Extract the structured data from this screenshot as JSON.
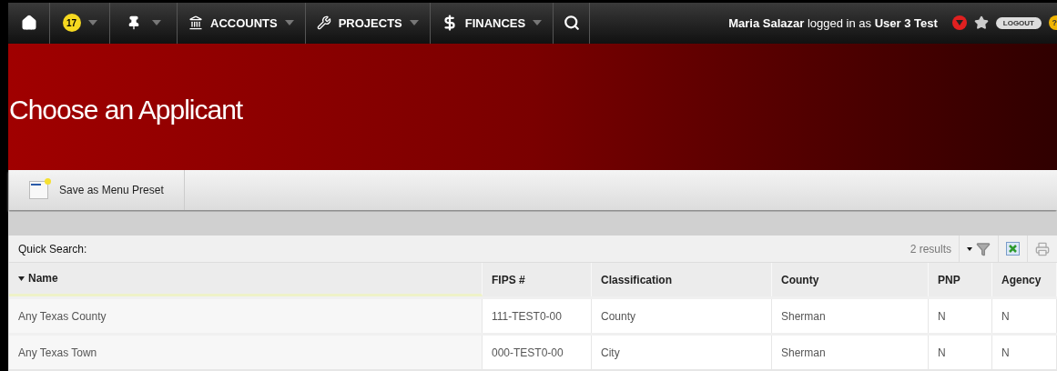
{
  "nav": {
    "badge": "17",
    "menus": [
      {
        "kind": "accounts",
        "label": "ACCOUNTS"
      },
      {
        "kind": "projects",
        "label": "PROJECTS"
      },
      {
        "kind": "finances",
        "label": "FINANCES"
      }
    ],
    "user_text": "**Maria Salazar** logged in as **User 3 Test**",
    "logout": "LOGOUT",
    "help": "?"
  },
  "page_title": "Choose an Applicant",
  "toolbar": {
    "button": "Save as Menu Preset"
  },
  "grid": {
    "quick_search": "Quick Search:",
    "results": "2 results",
    "columns": [
      {
        "label": "Name",
        "sorted": true
      },
      {
        "label": "FIPS #",
        "sorted": false
      },
      {
        "label": "Classification",
        "sorted": false
      },
      {
        "label": "County",
        "sorted": false
      },
      {
        "label": "PNP",
        "sorted": false
      },
      {
        "label": "Agency",
        "sorted": false
      }
    ],
    "rows": [
      [
        "Any Texas County",
        "111-TEST0-00",
        "County",
        "Sherman",
        "N",
        "N"
      ],
      [
        "Any Texas Town",
        "000-TEST0-00",
        "City",
        "Sherman",
        "N",
        "N"
      ]
    ]
  }
}
